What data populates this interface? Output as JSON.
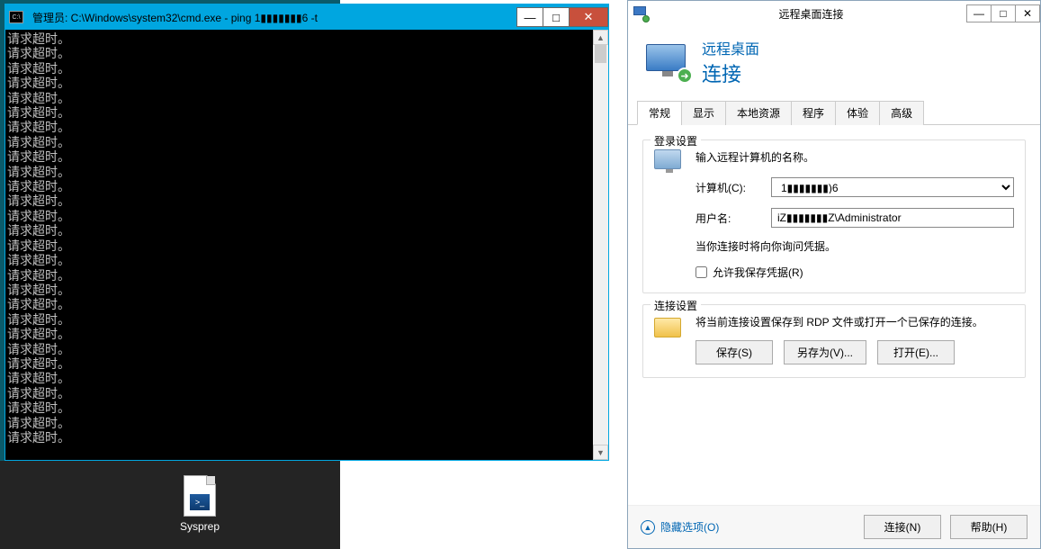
{
  "cmd": {
    "title": "管理员: C:\\Windows\\system32\\cmd.exe - ping  1▮▮▮▮▮▮▮6 -t",
    "line": "请求超时。",
    "line_count": 28
  },
  "desktop": {
    "sysprep_label": "Sysprep"
  },
  "rdp": {
    "title": "远程桌面连接",
    "header_t1": "远程桌面",
    "header_t2": "连接",
    "tabs": [
      "常规",
      "显示",
      "本地资源",
      "程序",
      "体验",
      "高级"
    ],
    "login_group_title": "登录设置",
    "login_desc": "输入远程计算机的名称。",
    "computer_label": "计算机(C):",
    "computer_value": "1▮▮▮▮▮▮▮)6",
    "username_label": "用户名:",
    "username_value": "iZ▮▮▮▮▮▮▮Z\\Administrator",
    "cred_note": "当你连接时将向你询问凭据。",
    "save_cred_label": "允许我保存凭据(R)",
    "conn_group_title": "连接设置",
    "conn_desc": "将当前连接设置保存到 RDP 文件或打开一个已保存的连接。",
    "save_btn": "保存(S)",
    "saveas_btn": "另存为(V)...",
    "open_btn": "打开(E)...",
    "hide_opt": "隐藏选项(O)",
    "connect_btn": "连接(N)",
    "help_btn": "帮助(H)"
  }
}
